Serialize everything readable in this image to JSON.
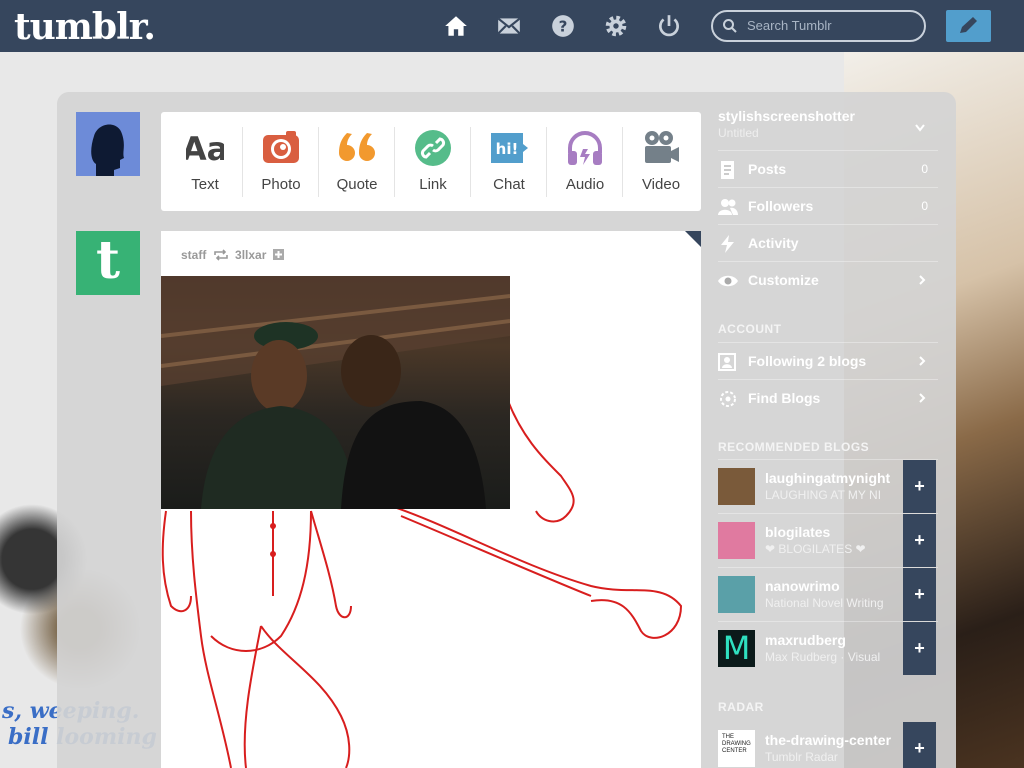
{
  "header": {
    "logo": "tumblr.",
    "search_placeholder": "Search Tumblr",
    "icons": [
      "home-icon",
      "mail-icon",
      "help-icon",
      "gear-icon",
      "power-icon"
    ],
    "accent": "#36465d",
    "compose_color": "#529ecc"
  },
  "post_types": [
    {
      "label": "Text",
      "icon": "text-icon",
      "color": "#444444"
    },
    {
      "label": "Photo",
      "icon": "camera-icon",
      "color": "#d95e40"
    },
    {
      "label": "Quote",
      "icon": "quote-icon",
      "color": "#f2992e"
    },
    {
      "label": "Link",
      "icon": "link-icon",
      "color": "#56bc8a"
    },
    {
      "label": "Chat",
      "icon": "chat-icon",
      "color": "#529ecc"
    },
    {
      "label": "Audio",
      "icon": "headphones-icon",
      "color": "#a77dc2"
    },
    {
      "label": "Video",
      "icon": "video-icon",
      "color": "#748089"
    }
  ],
  "post": {
    "author": "staff",
    "reblogged_from": "3llxar"
  },
  "sidebar": {
    "blog_name": "stylishscreenshotter",
    "blog_subtitle": "Untitled",
    "rows": [
      {
        "label": "Posts",
        "count": "0",
        "icon": "posts-icon"
      },
      {
        "label": "Followers",
        "count": "0",
        "icon": "followers-icon"
      },
      {
        "label": "Activity",
        "count": "",
        "icon": "activity-icon"
      },
      {
        "label": "Customize",
        "count": "",
        "icon": "eye-icon"
      }
    ],
    "account_heading": "ACCOUNT",
    "account_rows": [
      {
        "label": "Following 2 blogs",
        "icon": "following-icon"
      },
      {
        "label": "Find Blogs",
        "icon": "find-blogs-icon"
      }
    ],
    "recommended_heading": "RECOMMENDED BLOGS",
    "recommended": [
      {
        "name": "laughingatmynight",
        "sub": "LAUGHING AT MY NI",
        "thumb": "#7a5a3a"
      },
      {
        "name": "blogilates",
        "sub": "❤ BLOGILATES ❤",
        "thumb": "#e07aa0"
      },
      {
        "name": "nanowrimo",
        "sub": "National Novel Writing",
        "thumb": "#5aa0a8"
      },
      {
        "name": "maxrudberg",
        "sub": "Max Rudberg · Visual",
        "thumb": "#0b1a1a"
      }
    ],
    "radar_heading": "RADAR",
    "radar": {
      "name": "the-drawing-center",
      "sub": "Tumblr Radar",
      "thumb_text": "THE DRAWING CENTER"
    }
  },
  "background": {
    "left_text_1": "s, weeping.",
    "left_text_2": "bill looming"
  }
}
